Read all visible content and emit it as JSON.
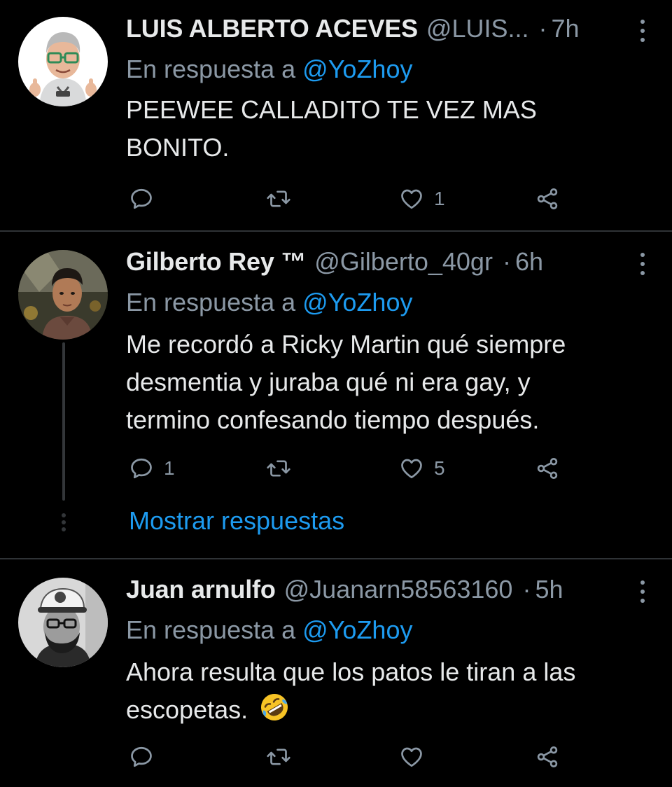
{
  "tweets": [
    {
      "name": "LUIS ALBERTO ACEVES",
      "handle": "@LUIS...",
      "time": "7h",
      "reply_prefix": "En respuesta a",
      "reply_mention": "@YoZhoy",
      "text_line1": "PEEWEE CALLADITO TE VEZ MAS",
      "text_line2": "BONITO.",
      "replies": "",
      "retweets": "",
      "likes": "1",
      "avatar": "memoji-avatar"
    },
    {
      "name": "Gilberto Rey ™",
      "handle": "@Gilberto_40gr",
      "time": "6h",
      "reply_prefix": "En respuesta a",
      "reply_mention": "@YoZhoy",
      "text_line1": "Me recordó a Ricky Martin qué siempre",
      "text_line2": "desmentia y juraba qué ni era gay, y",
      "text_line3": "termino confesando tiempo después.",
      "replies": "1",
      "retweets": "",
      "likes": "5",
      "avatar": "photo-avatar",
      "show_replies": "Mostrar respuestas"
    },
    {
      "name": "Juan arnulfo",
      "handle": "@Juanarn58563160",
      "time": "5h",
      "reply_prefix": "En respuesta a",
      "reply_mention": "@YoZhoy",
      "text_line1": "Ahora resulta que los patos le tiran a las",
      "text_line2": "escopetas.",
      "emoji": "rolling-on-floor-laughing-emoji",
      "replies": "",
      "retweets": "",
      "likes": "",
      "avatar": "bw-photo-avatar"
    }
  ],
  "icons": {
    "reply": "reply-icon",
    "retweet": "retweet-icon",
    "like": "heart-icon",
    "share": "share-icon",
    "more": "more-icon"
  },
  "colors": {
    "background": "#000000",
    "text": "#e7e9ea",
    "muted": "#8b98a5",
    "accent": "#1d9bf0",
    "divider": "#2f3336"
  }
}
